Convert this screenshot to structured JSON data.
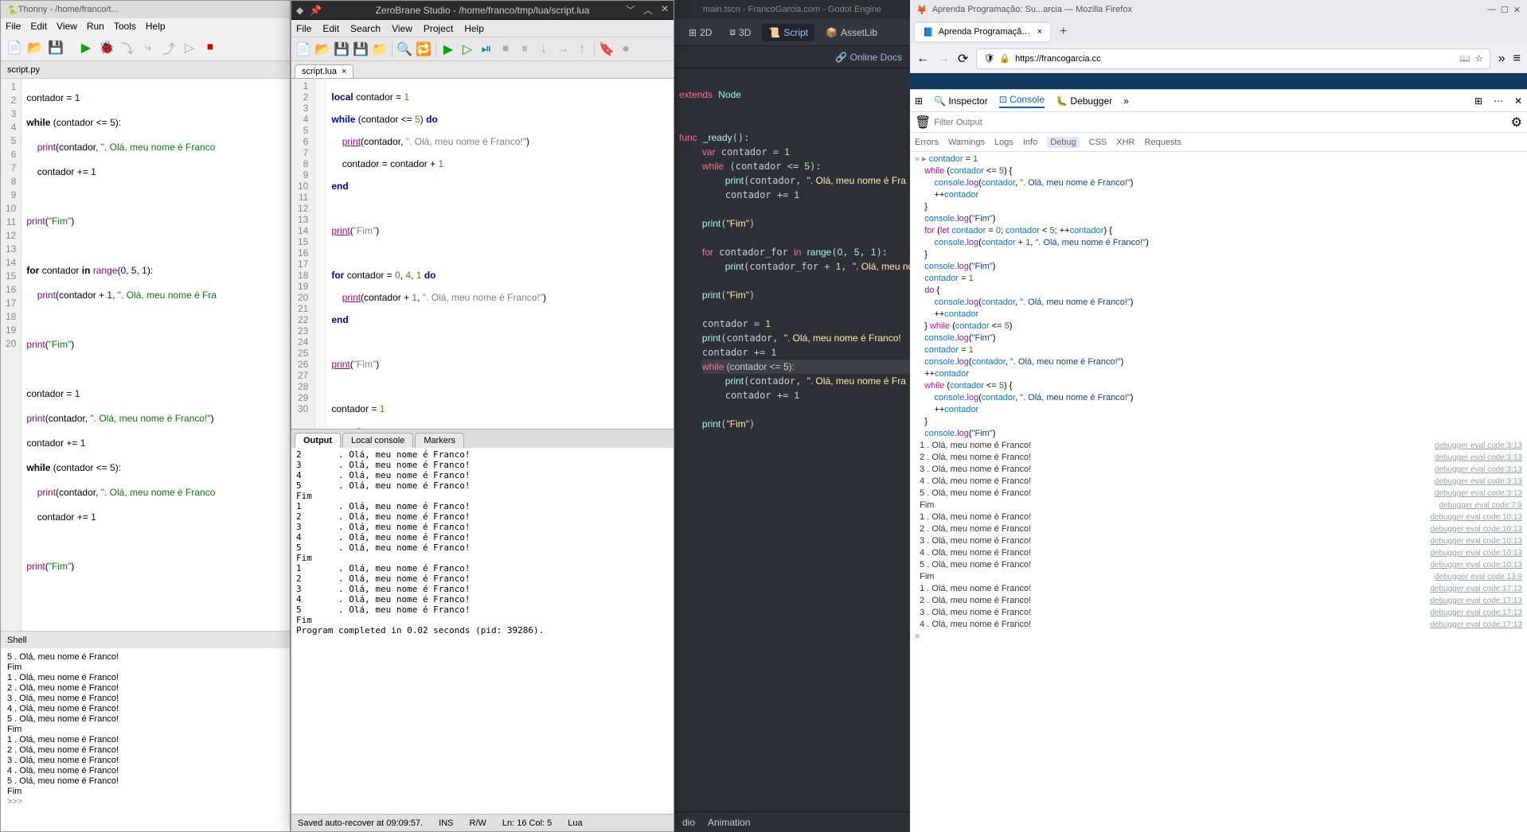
{
  "thonny": {
    "title": "Thonny - /home/franco/t...",
    "menu": [
      "File",
      "Edit",
      "View",
      "Run",
      "Tools",
      "Help"
    ],
    "tab": "script.py",
    "lines": [
      1,
      2,
      3,
      4,
      5,
      6,
      7,
      8,
      9,
      10,
      11,
      12,
      13,
      14,
      15,
      16,
      17,
      18,
      19,
      20
    ],
    "shell_tab": "Shell",
    "shell": "5 . Olá, meu nome é Franco!\nFim\n1 . Olá, meu nome é Franco!\n2 . Olá, meu nome é Franco!\n3 . Olá, meu nome é Franco!\n4 . Olá, meu nome é Franco!\n5 . Olá, meu nome é Franco!\nFim\n1 . Olá, meu nome é Franco!\n2 . Olá, meu nome é Franco!\n3 . Olá, meu nome é Franco!\n4 . Olá, meu nome é Franco!\n5 . Olá, meu nome é Franco!\nFim",
    "prompt": ">>>"
  },
  "zb": {
    "title": "ZeroBrane Studio - /home/franco/tmp/lua/script.lua",
    "menu": [
      "File",
      "Edit",
      "Search",
      "View",
      "Project",
      "Help"
    ],
    "tab": "script.lua",
    "lines": [
      1,
      2,
      3,
      4,
      5,
      6,
      7,
      8,
      9,
      10,
      11,
      12,
      13,
      14,
      15,
      16,
      17,
      18,
      19,
      20,
      21,
      22,
      23,
      24,
      25,
      26,
      27,
      28,
      29,
      30
    ],
    "out_tabs": [
      "Output",
      "Local console",
      "Markers"
    ],
    "output": "2       . Olá, meu nome é Franco!\n3       . Olá, meu nome é Franco!\n4       . Olá, meu nome é Franco!\n5       . Olá, meu nome é Franco!\nFim\n1       . Olá, meu nome é Franco!\n2       . Olá, meu nome é Franco!\n3       . Olá, meu nome é Franco!\n4       . Olá, meu nome é Franco!\n5       . Olá, meu nome é Franco!\nFim\n1       . Olá, meu nome é Franco!\n2       . Olá, meu nome é Franco!\n3       . Olá, meu nome é Franco!\n4       . Olá, meu nome é Franco!\n5       . Olá, meu nome é Franco!\nFim\nProgram completed in 0.02 seconds (pid: 39286).",
    "status": {
      "save": "Saved auto-recover at 09:09:57.",
      "ins": "INS",
      "rw": "R/W",
      "pos": "Ln: 16 Col: 5",
      "lang": "Lua"
    }
  },
  "godot": {
    "title": "main.tscn - FrancoGarcia.com - Godot Engine",
    "tabs": {
      "2d": "2D",
      "3d": "3D",
      "script": "Script",
      "asset": "AssetLib"
    },
    "docs": "Online Docs",
    "bottom": {
      "dio": "dio",
      "anim": "Animation"
    }
  },
  "ff": {
    "title": "Aprenda Programação: Su...arcia — Mozilla Firefox",
    "tab": "Aprenda Programação: Subro",
    "url": "https://francogarcia.cc",
    "dt": {
      "tabs": {
        "insp": "Inspector",
        "cons": "Console",
        "dbg": "Debugger"
      },
      "filter_ph": "Filter Output",
      "cats": [
        "Errors",
        "Warnings",
        "Logs",
        "Info",
        "Debug",
        "CSS",
        "XHR",
        "Requests"
      ],
      "results": [
        {
          "t": "1 . Olá, meu nome é Franco!",
          "s": "debugger eval code:3:13"
        },
        {
          "t": "2 . Olá, meu nome é Franco!",
          "s": "debugger eval code:3:13"
        },
        {
          "t": "3 . Olá, meu nome é Franco!",
          "s": "debugger eval code:3:13"
        },
        {
          "t": "4 . Olá, meu nome é Franco!",
          "s": "debugger eval code:3:13"
        },
        {
          "t": "5 . Olá, meu nome é Franco!",
          "s": "debugger eval code:3:13"
        },
        {
          "t": "Fim",
          "s": "debugger eval code:7:9"
        },
        {
          "t": "1 . Olá, meu nome é Franco!",
          "s": "debugger eval code:10:13"
        },
        {
          "t": "2 . Olá, meu nome é Franco!",
          "s": "debugger eval code:10:13"
        },
        {
          "t": "3 . Olá, meu nome é Franco!",
          "s": "debugger eval code:10:13"
        },
        {
          "t": "4 . Olá, meu nome é Franco!",
          "s": "debugger eval code:10:13"
        },
        {
          "t": "5 . Olá, meu nome é Franco!",
          "s": "debugger eval code:10:13"
        },
        {
          "t": "Fim",
          "s": "debugger eval code:13:9"
        },
        {
          "t": "1 . Olá, meu nome é Franco!",
          "s": "debugger eval code:17:13"
        },
        {
          "t": "2 . Olá, meu nome é Franco!",
          "s": "debugger eval code:17:13"
        },
        {
          "t": "3 . Olá, meu nome é Franco!",
          "s": "debugger eval code:17:13"
        },
        {
          "t": "4 . Olá, meu nome é Franco!",
          "s": "debugger eval code:17:13"
        }
      ]
    }
  }
}
